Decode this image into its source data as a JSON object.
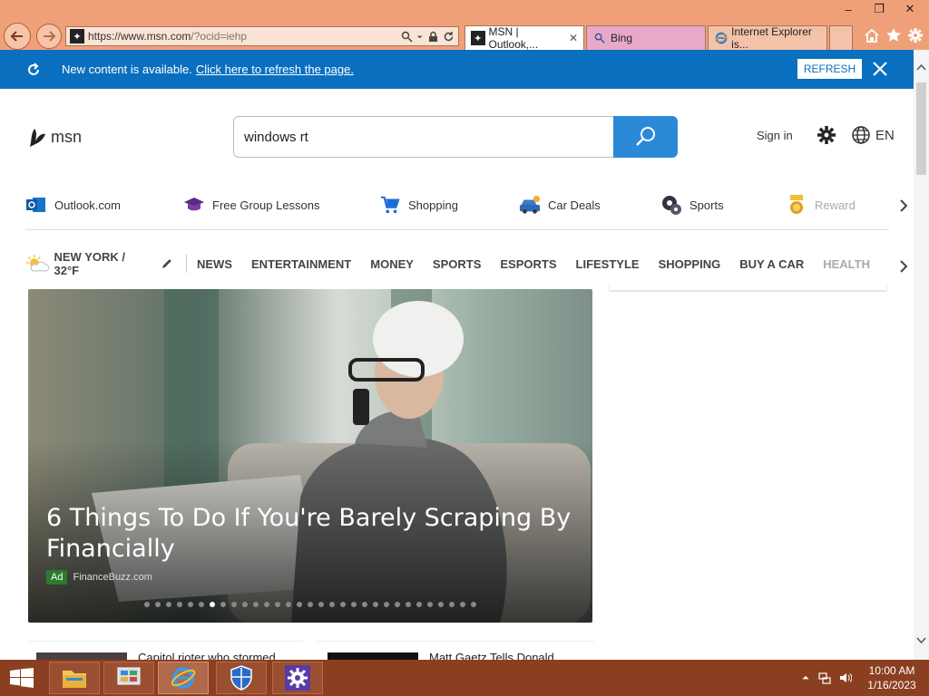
{
  "browser": {
    "url_main": "https://www.msn.com",
    "url_rest": "/?ocid=iehp",
    "tabs": [
      {
        "label": "MSN | Outlook,..."
      },
      {
        "label": "Bing"
      },
      {
        "label": "Internet Explorer is..."
      }
    ]
  },
  "notification": {
    "text": "New content is available.",
    "link": "Click here to refresh the page.",
    "button": "REFRESH"
  },
  "header": {
    "logo": "msn",
    "search_value": "windows rt",
    "signin": "Sign in",
    "lang": "EN"
  },
  "quicklinks": [
    {
      "label": "Outlook.com"
    },
    {
      "label": "Free Group Lessons"
    },
    {
      "label": "Shopping"
    },
    {
      "label": "Car Deals"
    },
    {
      "label": "Sports"
    },
    {
      "label": "Rewards"
    }
  ],
  "weather": {
    "label": "NEW YORK / 32°F"
  },
  "categories": [
    "NEWS",
    "ENTERTAINMENT",
    "MONEY",
    "SPORTS",
    "ESPORTS",
    "LIFESTYLE",
    "SHOPPING",
    "BUY A CAR",
    "HEALTH"
  ],
  "hero": {
    "title": "6 Things To Do If You're Barely Scraping By Financially",
    "badge": "Ad",
    "source": "FinanceBuzz.com",
    "slide_count": 31,
    "active_slide": 6
  },
  "cards": [
    {
      "title": "Capitol rioter who stormed"
    },
    {
      "title": "Matt Gaetz Tells Donald"
    }
  ],
  "taskbar": {
    "time": "10:00 AM",
    "date": "1/16/2023"
  },
  "colors": {
    "chrome": "#f0a078",
    "notification": "#0a6fbf",
    "search_button": "#2b8ad8",
    "taskbar": "#8a4020"
  }
}
